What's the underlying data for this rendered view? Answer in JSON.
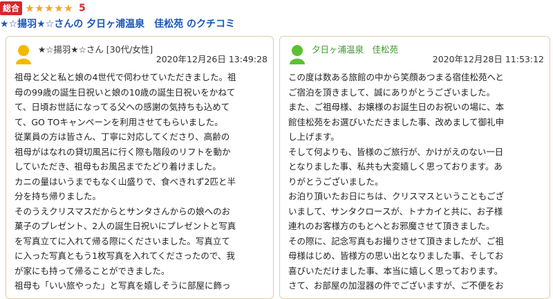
{
  "header": {
    "badge": "総合",
    "score": "5",
    "stars": 5,
    "title": "★☆揚羽★☆さんの 夕日ヶ浦温泉　佳松苑 のクチコミ"
  },
  "review": {
    "author": "★☆揚羽★☆さん [30代/女性]",
    "date": "2020年12月26日 13:49:28",
    "lines": [
      "祖母と父と私と娘の4世代で伺わせていただきました。祖",
      "母の99歳の誕生日祝いと娘の10歳の誕生日祝いをかねて",
      "て、日頃お世話になってる父への感謝の気持ちも込めて",
      "て、GO TOキャンペーンを利用させてもらいました。",
      "従業員の方は皆さん、丁寧に対応してくださり、高齢の",
      "祖母がはなれの貸切風呂に行く際も階段のリフトを動か",
      "していただき、祖母もお風呂までたどり着けました。",
      "カニの量はいうまでもなく山盛りで、食べきれず2匹と半",
      "分を持ち帰りました。",
      "そのうえクリスマスだからとサンタさんからの娘へのお",
      "菓子のプレゼント、2人の誕生日祝いにプレゼントと写真",
      "を写真立てに入れて帰る際にくださいました。写真立て",
      "に入った写真ともう1枚写真を入れてくださったので、我",
      "が家にも持って帰ることができました。",
      "祖母も「いい旅やった」と写真を嬉しそうに部屋に飾っ"
    ]
  },
  "reply": {
    "author": "夕日ヶ浦温泉　佳松苑",
    "date": "2020年12月28日 11:53:12",
    "lines": [
      "この度は数ある旅館の中から笑顔あつまる宿佳松苑へと",
      "ご宿泊を頂きまして、誠にありがとうございました。",
      "また、ご祖母様、お嬢様のお誕生日のお祝いの場に、本",
      "館佳松苑をお選びいただきました事、改めまして御礼申",
      "し上げます。",
      "そして何よりも、皆様のご旅行が、かけがえのない一日",
      "となりました事、私共も大変嬉しく思っております。あ",
      "りがとうございました。",
      "お泊り頂いたお日にちは、クリスマスということもござ",
      "いまして、サンタクロースが、トナカイと共に、お子様",
      "連れのお客様方のもとへとお邪魔させて頂きました。",
      "その際に、記念写真もお撮りさせて頂きましたが、ご祖",
      "母様はじめ、皆様方の思い出となりました事、そしてお",
      "喜びいただけました事、本当に嬉しく思っております。",
      "さて、お部屋の加湿器の件でございますが、ご不便をお"
    ]
  },
  "colors": {
    "badge_red": "#d7262d",
    "star_gold": "#f5a623",
    "title_blue": "#1a56b8",
    "hotel_green": "#3a9a2a",
    "card_border": "#e3cba6",
    "avatar_yellow": "#f5b800",
    "avatar_green": "#5cc130"
  }
}
